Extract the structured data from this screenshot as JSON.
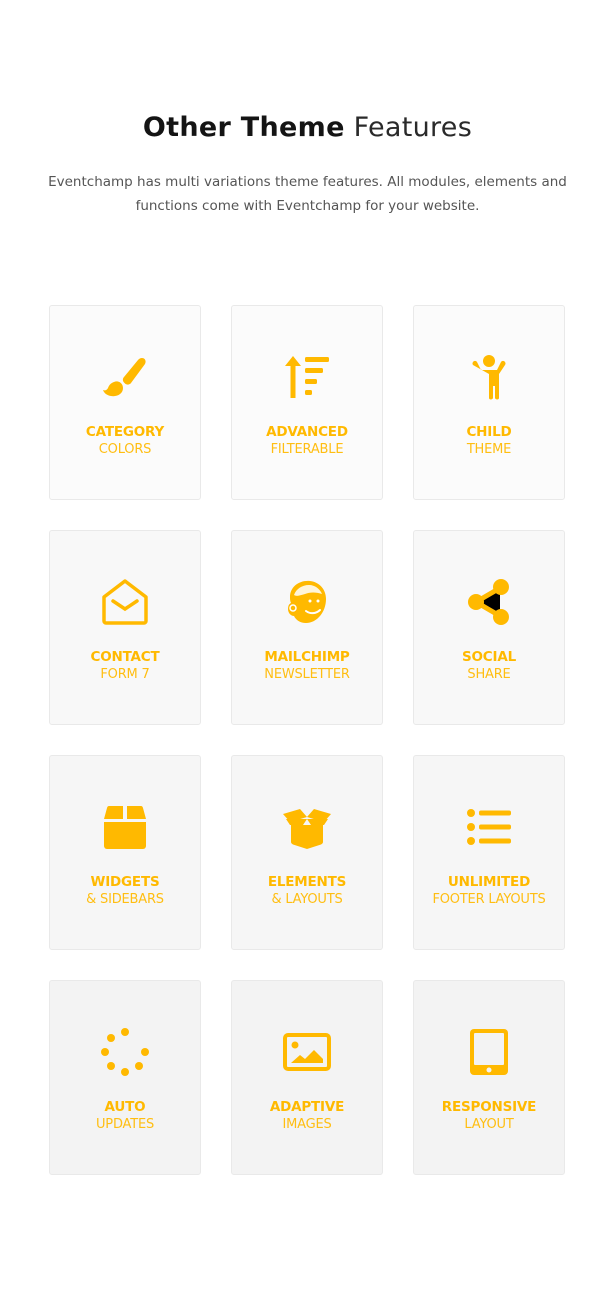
{
  "header": {
    "title_bold": "Other Theme",
    "title_light": "Features",
    "subtitle_line1": "Eventchamp has multi variations theme features. All modules, elements and",
    "subtitle_line2": "functions come with Eventchamp for your website."
  },
  "colors": {
    "accent": "#ffb900",
    "title": "#141414",
    "body_text": "#555555"
  },
  "features": [
    {
      "icon": "paint-brush-icon",
      "line1": "Category",
      "line2": "Colors"
    },
    {
      "icon": "sort-filter-icon",
      "line1": "Advanced",
      "line2": "Filterable"
    },
    {
      "icon": "child-icon",
      "line1": "Child",
      "line2": "Theme"
    },
    {
      "icon": "envelope-open-icon",
      "line1": "Contact",
      "line2": "Form 7"
    },
    {
      "icon": "mailchimp-icon",
      "line1": "Mailchimp",
      "line2": "Newsletter"
    },
    {
      "icon": "share-icon",
      "line1": "Social",
      "line2": "Share"
    },
    {
      "icon": "box-icon",
      "line1": "Widgets",
      "line2": "& Sidebars"
    },
    {
      "icon": "box-open-icon",
      "line1": "Elements",
      "line2": "& Layouts"
    },
    {
      "icon": "list-icon",
      "line1": "Unlimited",
      "line2": "Footer Layouts"
    },
    {
      "icon": "spinner-icon",
      "line1": "Auto",
      "line2": "Updates"
    },
    {
      "icon": "image-icon",
      "line1": "Adaptive",
      "line2": "Images"
    },
    {
      "icon": "tablet-icon",
      "line1": "Responsive",
      "line2": "Layout"
    }
  ]
}
